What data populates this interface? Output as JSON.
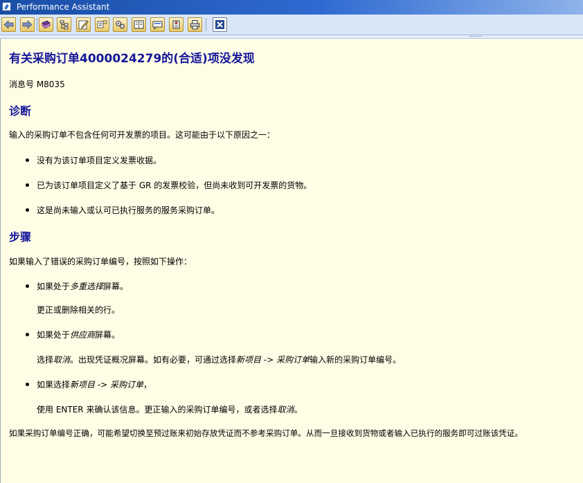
{
  "window": {
    "title": "Performance Assistant"
  },
  "toolbar": {
    "buttons": [
      {
        "name": "back-button",
        "icon": "arrow-left-icon"
      },
      {
        "name": "forward-button",
        "icon": "arrow-right-icon"
      },
      {
        "name": "technical-info-button",
        "icon": "book-icon"
      },
      {
        "name": "structure-button",
        "icon": "tree-icon"
      },
      {
        "name": "edit-button",
        "icon": "pencil-icon"
      },
      {
        "name": "mark-button",
        "icon": "highlight-icon"
      },
      {
        "name": "settings-button",
        "icon": "gears-icon"
      },
      {
        "name": "display-button",
        "icon": "book-open-icon"
      },
      {
        "name": "comment-button",
        "icon": "note-icon"
      },
      {
        "name": "attach-button",
        "icon": "doc-pin-icon"
      },
      {
        "name": "print-button",
        "icon": "printer-icon"
      },
      {
        "name": "close-button",
        "icon": "close-icon"
      }
    ]
  },
  "doc": {
    "title": "有关采购订单4000024279的(合适)项没发现",
    "message_number": "消息号 M8035",
    "diagnosis_heading": "诊断",
    "diagnosis_text": "输入的采购订单不包含任何可开发票的项目。这可能由于以下原因之一：",
    "diagnosis_bullets": [
      "没有为该订单项目定义发票收据。",
      "已为该订单项目定义了基于 GR 的发票校验，但尚未收到可开发票的货物。",
      "这是尚未输入或认可已执行服务的服务采购订单。"
    ],
    "steps_heading": "步骤",
    "steps_intro": "如果输入了错误的采购订单编号，按照如下操作：",
    "step1": {
      "pre": "如果处于",
      "em": "多重选择",
      "post": "屏幕。",
      "detail": "更正或删除相关的行。"
    },
    "step2": {
      "pre": "如果处于",
      "em": "供应商",
      "post": "屏幕。",
      "d_pre": "选择",
      "d_em1": "取消",
      "d_mid": "。出现凭证概况屏幕。如有必要，可通过选择",
      "d_em2": "新项目 -> 采购订单",
      "d_post": "输入新的采购订单编号。"
    },
    "step3": {
      "pre": "如果选择",
      "em": "新项目 -> 采购订单",
      "post": "，",
      "d_pre": "使用 ENTER 来确认该信息。更正输入的采购订单编号，或者选择",
      "d_em": "取消",
      "d_post": "。"
    },
    "closing": "如果采购订单编号正确，可能希望切换至预过账来初始存放凭证而不参考采购订单。从而一旦接收到货物或者输入已执行的服务即可过账该凭证。"
  }
}
